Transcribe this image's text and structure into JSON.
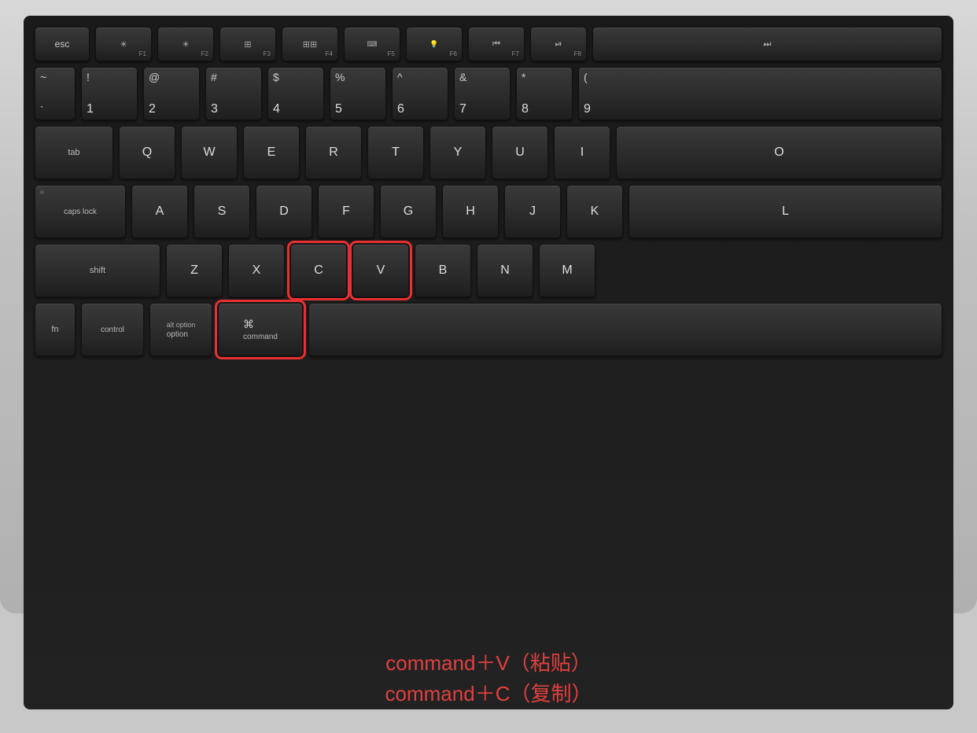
{
  "keyboard": {
    "background_color": "#c0c0c0",
    "rows": {
      "fn_row": [
        "esc",
        "F1",
        "F2",
        "F3",
        "F4",
        "F5",
        "F6",
        "F7",
        "F8"
      ],
      "num_row": [
        "~`",
        "!1",
        "@2",
        "#3",
        "$4",
        "%5",
        "^6",
        "&7",
        "*8",
        "9"
      ],
      "qwerty_row": [
        "tab",
        "Q",
        "W",
        "E",
        "R",
        "T",
        "Y",
        "U",
        "I"
      ],
      "asdf_row": [
        "caps lock",
        "A",
        "S",
        "D",
        "F",
        "G",
        "H",
        "J",
        "K"
      ],
      "zxcv_row": [
        "shift",
        "Z",
        "X",
        "C",
        "V",
        "B",
        "N",
        "M"
      ],
      "bottom_row": [
        "fn",
        "control",
        "alt option",
        "command",
        "space"
      ]
    },
    "highlighted_keys": [
      "C",
      "V",
      "command"
    ],
    "annotation": {
      "line1": "command＋V（粘贴）",
      "line2": "command＋C（复制）"
    }
  }
}
